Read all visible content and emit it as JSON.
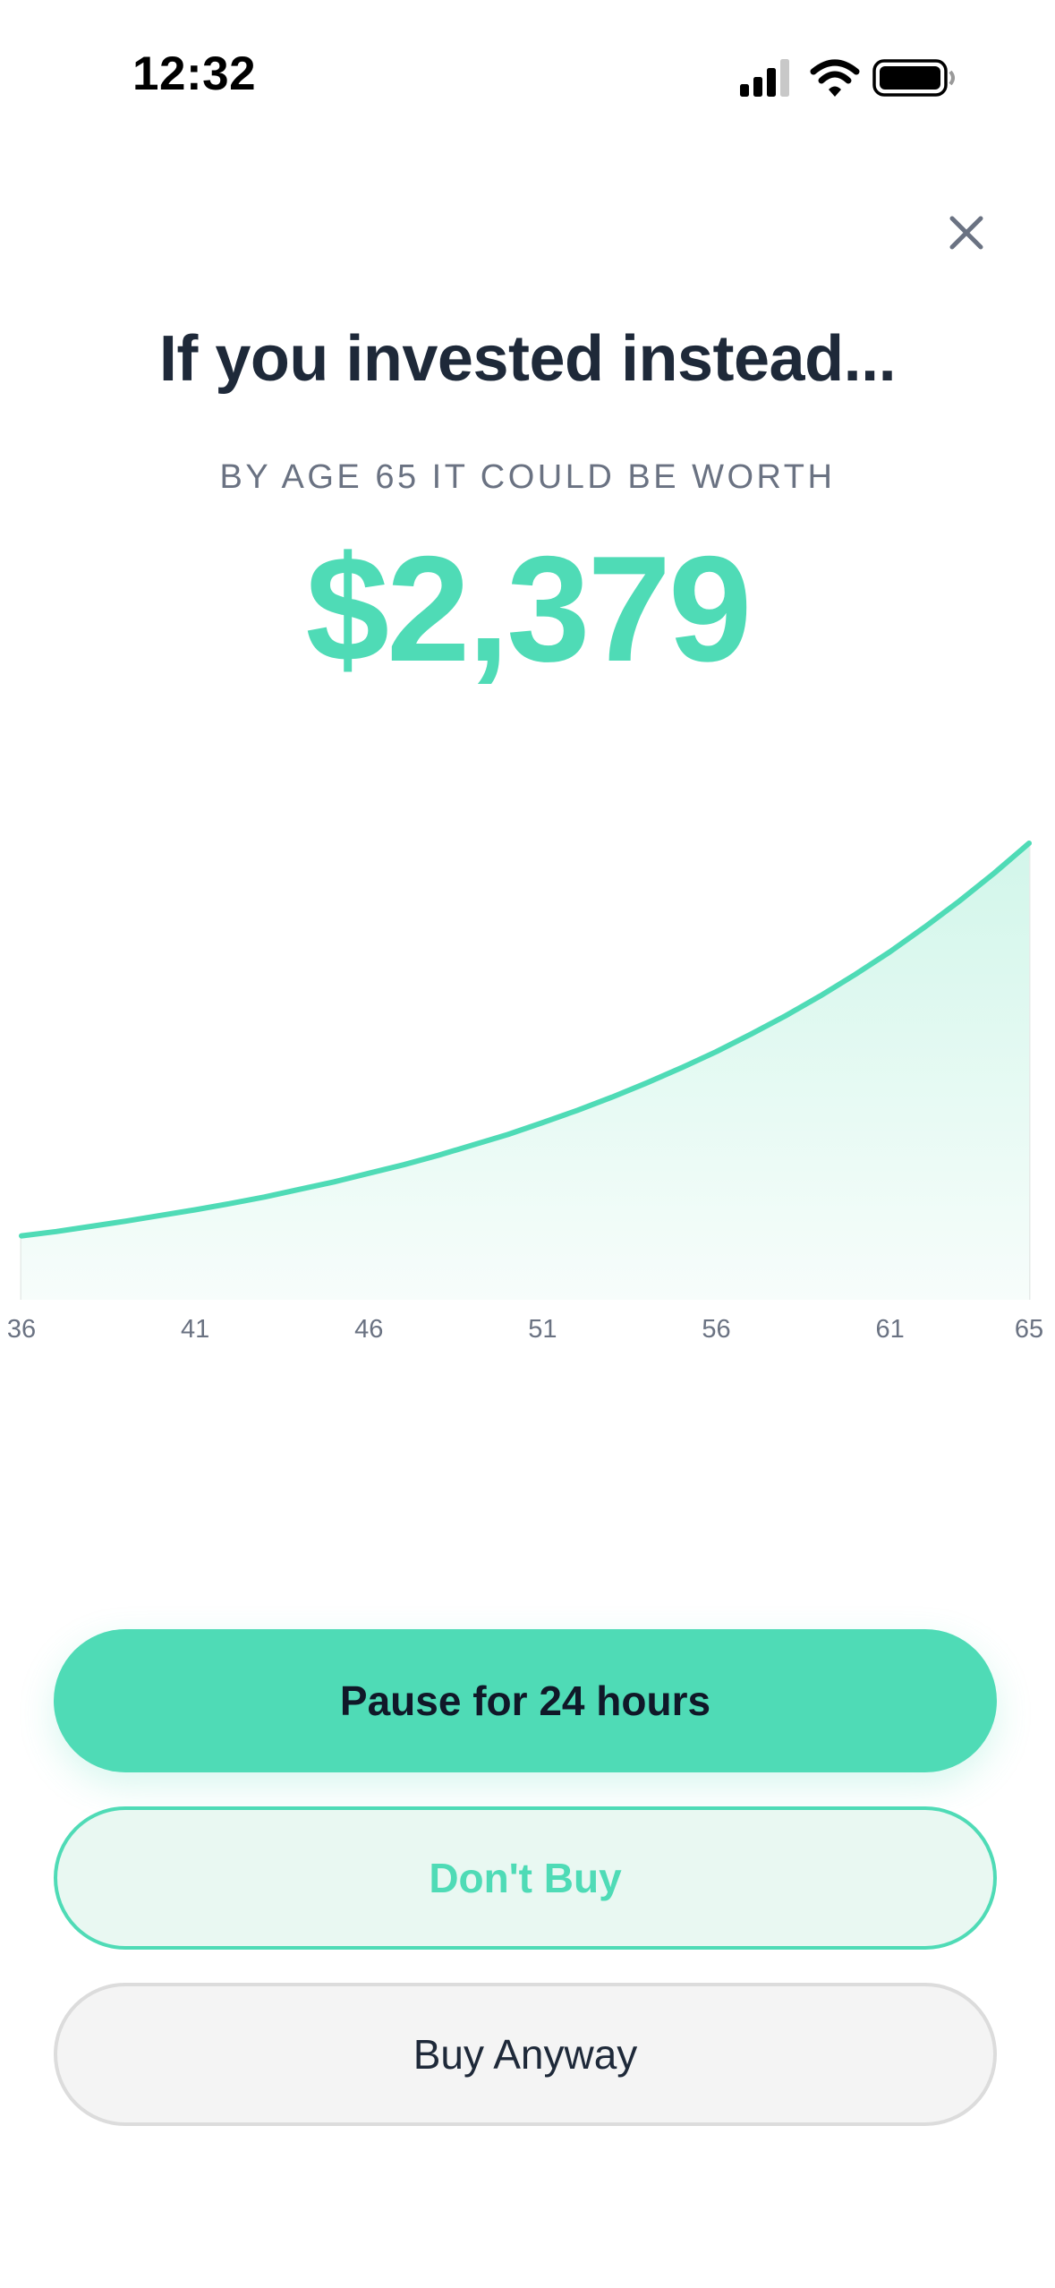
{
  "status_bar": {
    "time": "12:32",
    "icons": [
      "cellular-signal-icon",
      "wifi-icon",
      "battery-icon"
    ]
  },
  "header": {
    "close_icon": "close-icon"
  },
  "main": {
    "title": "If you invested instead...",
    "subtitle": "BY AGE 65 IT COULD BE WORTH",
    "amount": "$2,379"
  },
  "chart_data": {
    "type": "area",
    "x": [
      36,
      37,
      38,
      39,
      40,
      41,
      42,
      43,
      44,
      45,
      46,
      47,
      48,
      49,
      50,
      51,
      52,
      53,
      54,
      55,
      56,
      57,
      58,
      59,
      60,
      61,
      62,
      63,
      64,
      65
    ],
    "values": [
      135,
      144,
      155,
      166,
      178,
      190,
      203,
      217,
      233,
      249,
      267,
      285,
      305,
      327,
      349,
      374,
      400,
      428,
      458,
      490,
      524,
      561,
      600,
      642,
      687,
      735,
      787,
      842,
      901,
      964
    ],
    "tick_labels": [
      "36",
      "41",
      "46",
      "51",
      "56",
      "61",
      "65"
    ],
    "title": "",
    "xlabel": "",
    "ylabel": "",
    "grid": "vertical",
    "colors": {
      "line": "#4fdbb6",
      "fill_top": "#d2f6ea",
      "fill_bottom": "#f7fdfb",
      "bars": "#e6ebe9",
      "ticks": "#6a7282"
    }
  },
  "actions": {
    "primary_label": "Pause for 24 hours",
    "secondary_label": "Don't Buy",
    "tertiary_label": "Buy Anyway"
  },
  "colors": {
    "accent": "#4fdbb6",
    "text": "#1e2939",
    "muted": "#6a7282"
  }
}
